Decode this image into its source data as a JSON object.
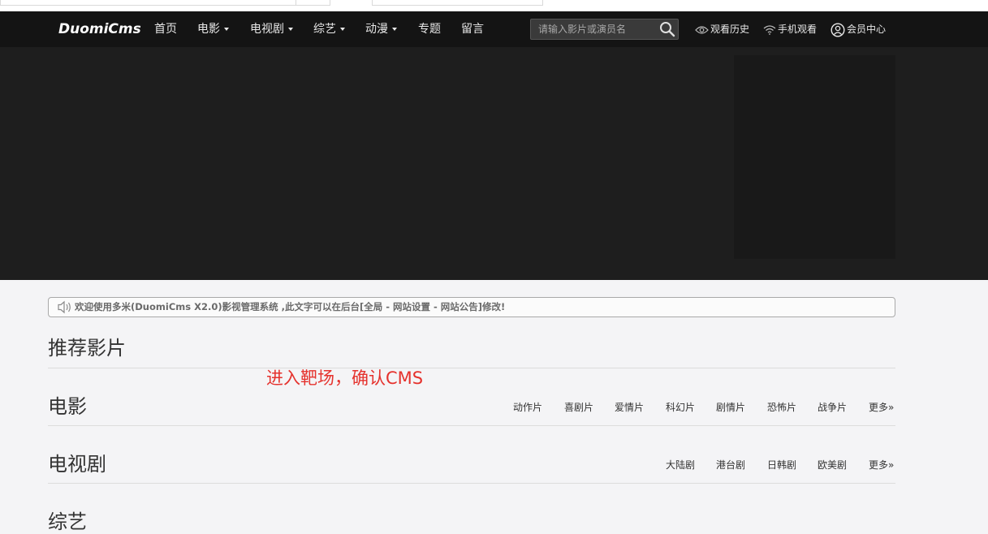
{
  "header": {
    "logo": "DuomiCms",
    "nav": [
      {
        "label": "首页",
        "dropdown": false
      },
      {
        "label": "电影",
        "dropdown": true
      },
      {
        "label": "电视剧",
        "dropdown": true
      },
      {
        "label": "综艺",
        "dropdown": true
      },
      {
        "label": "动漫",
        "dropdown": true
      },
      {
        "label": "专题",
        "dropdown": false
      },
      {
        "label": "留言",
        "dropdown": false
      }
    ],
    "search": {
      "placeholder": "请输入影片或演员名",
      "value": ""
    },
    "tools": {
      "history": "观看历史",
      "mobile": "手机观看",
      "member": "会员中心"
    }
  },
  "notice": {
    "icon": "speaker-icon",
    "text": "欢迎使用多米(DuomiCms X2.0)影视管理系统 ,此文字可以在后台[全局 - 网站设置 - 网站公告]修改!"
  },
  "sections": {
    "recommended": {
      "title": "推荐影片"
    },
    "movies": {
      "title": "电影",
      "categories": [
        "动作片",
        "喜剧片",
        "爱情片",
        "科幻片",
        "剧情片",
        "恐怖片",
        "战争片"
      ],
      "more": "更多»"
    },
    "tv": {
      "title": "电视剧",
      "categories": [
        "大陆剧",
        "港台剧",
        "日韩剧",
        "欧美剧"
      ],
      "more": "更多»"
    },
    "variety": {
      "title": "综艺"
    }
  },
  "annotation": "进入靶场，确认CMS",
  "colors": {
    "navbar": "#141414",
    "banner": "#1e1e1e",
    "page": "#f4f4f6",
    "annotation": "#e5322d"
  }
}
